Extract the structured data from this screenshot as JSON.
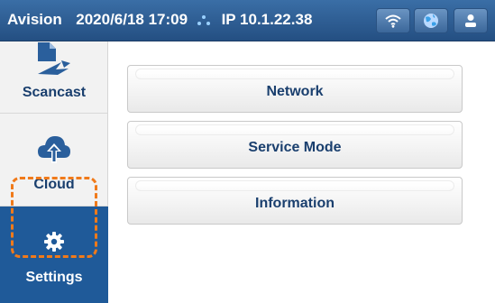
{
  "statusbar": {
    "brand": "Avision",
    "datetime": "2020/6/18 17:09",
    "ip": "IP 10.1.22.38",
    "icons": [
      "wifi-icon",
      "globe-icon",
      "user-icon"
    ]
  },
  "sidebar": {
    "items": [
      {
        "label": "Scancast",
        "icon": "scancast-icon"
      },
      {
        "label": "Cloud",
        "icon": "cloud-upload-icon"
      },
      {
        "label": "Settings",
        "icon": "gear-icon",
        "selected": true
      }
    ]
  },
  "menu": {
    "items": [
      {
        "label": "Network"
      },
      {
        "label": "Service Mode"
      },
      {
        "label": "Information"
      }
    ]
  },
  "colors": {
    "statusbar": "#2c5d93",
    "selected_sidebar": "#1f5a99",
    "label_text": "#1a3f6e",
    "highlight": "#f07a1a"
  }
}
